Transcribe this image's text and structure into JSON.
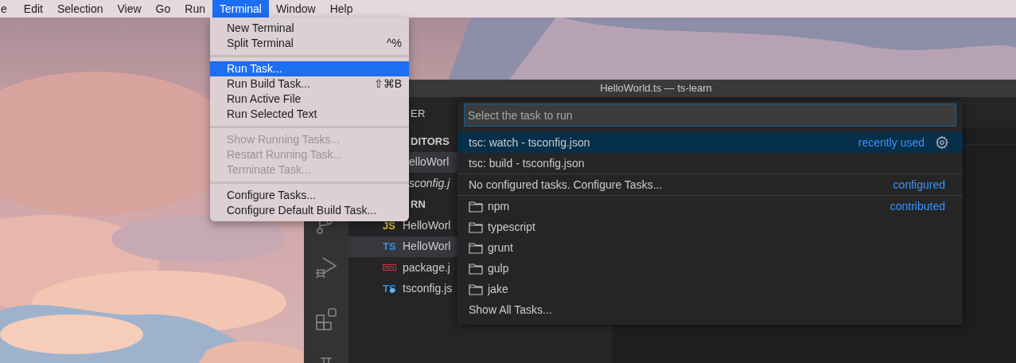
{
  "menu_bar": {
    "items": [
      {
        "label": "e",
        "selected": false
      },
      {
        "label": "Edit",
        "selected": false
      },
      {
        "label": "Selection",
        "selected": false
      },
      {
        "label": "View",
        "selected": false
      },
      {
        "label": "Go",
        "selected": false
      },
      {
        "label": "Run",
        "selected": false
      },
      {
        "label": "Terminal",
        "selected": true
      },
      {
        "label": "Window",
        "selected": false
      },
      {
        "label": "Help",
        "selected": false
      }
    ]
  },
  "terminal_menu": {
    "items": [
      {
        "kind": "item",
        "label": "New Terminal",
        "disabled": false,
        "selected": false
      },
      {
        "kind": "item",
        "label": "Split Terminal",
        "shortcut": "^%",
        "disabled": false,
        "selected": false
      },
      {
        "kind": "separator"
      },
      {
        "kind": "item",
        "label": "Run Task...",
        "disabled": false,
        "selected": true
      },
      {
        "kind": "item",
        "label": "Run Build Task...",
        "shortcut": "⇧⌘B",
        "disabled": false,
        "selected": false
      },
      {
        "kind": "item",
        "label": "Run Active File",
        "disabled": false,
        "selected": false
      },
      {
        "kind": "item",
        "label": "Run Selected Text",
        "disabled": false,
        "selected": false
      },
      {
        "kind": "separator"
      },
      {
        "kind": "item",
        "label": "Show Running Tasks...",
        "disabled": true,
        "selected": false
      },
      {
        "kind": "item",
        "label": "Restart Running Task...",
        "disabled": true,
        "selected": false
      },
      {
        "kind": "item",
        "label": "Terminate Task...",
        "disabled": true,
        "selected": false
      },
      {
        "kind": "separator"
      },
      {
        "kind": "item",
        "label": "Configure Tasks...",
        "disabled": false,
        "selected": false
      },
      {
        "kind": "item",
        "label": "Configure Default Build Task...",
        "disabled": false,
        "selected": false
      }
    ]
  },
  "window": {
    "title": "HelloWorld.ts — ts-learn"
  },
  "explorer": {
    "header": "ER",
    "open_editors": {
      "header": "DITORS",
      "items": [
        {
          "label": "elloWorl",
          "selected": true,
          "italic": false
        },
        {
          "label": "sconfig.j",
          "selected": false,
          "italic": true
        }
      ]
    },
    "folder": {
      "header": "RN",
      "files": [
        {
          "kind": "js",
          "icon": "JS",
          "label": "HelloWorl",
          "selected": false
        },
        {
          "kind": "ts",
          "icon": "TS",
          "label": "HelloWorl",
          "selected": true
        },
        {
          "kind": "npm",
          "label": "package.j",
          "selected": false
        },
        {
          "kind": "tsconfig",
          "icon": "TS",
          "label": "tsconfig.js",
          "selected": false
        }
      ]
    }
  },
  "quick_pick": {
    "placeholder": "Select the task to run",
    "items": [
      {
        "kind": "task",
        "label": "tsc: watch - tsconfig.json",
        "detail": "recently used",
        "selected": true
      },
      {
        "kind": "task",
        "label": "tsc: build - tsconfig.json",
        "selected": false
      },
      {
        "kind": "separator"
      },
      {
        "kind": "task",
        "label": "No configured tasks. Configure Tasks...",
        "detail": "configured",
        "selected": false
      },
      {
        "kind": "separator"
      },
      {
        "kind": "folder",
        "label": "npm",
        "detail": "contributed",
        "selected": false
      },
      {
        "kind": "folder",
        "label": "typescript",
        "selected": false
      },
      {
        "kind": "folder",
        "label": "grunt",
        "selected": false
      },
      {
        "kind": "folder",
        "label": "gulp",
        "selected": false
      },
      {
        "kind": "folder",
        "label": "jake",
        "selected": false
      },
      {
        "kind": "task",
        "label": "Show All Tasks...",
        "selected": false
      }
    ]
  }
}
